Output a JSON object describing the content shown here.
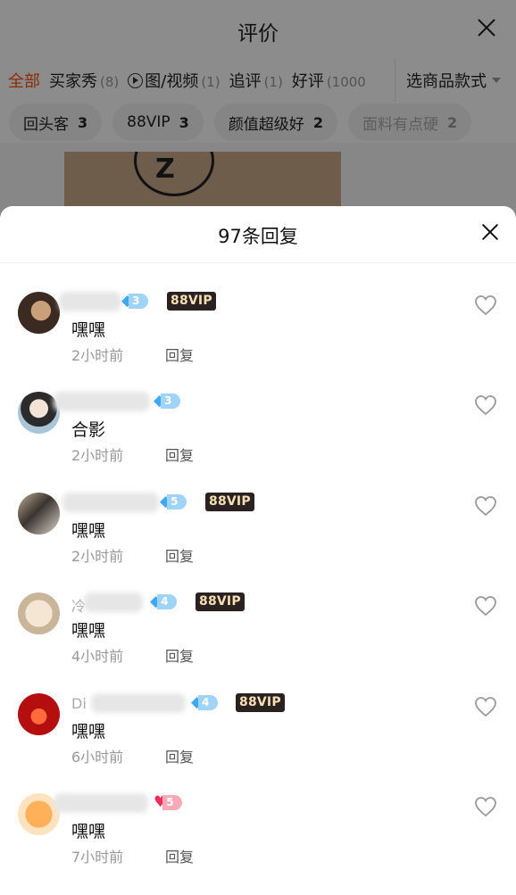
{
  "background": {
    "title": "评价",
    "tabs": [
      {
        "label": "全部",
        "count": ""
      },
      {
        "label": "买家秀",
        "count": "(8)"
      },
      {
        "label": "图/视频",
        "count": "(1)"
      },
      {
        "label": "追评",
        "count": "(1)"
      },
      {
        "label": "好评",
        "count": "(1000"
      }
    ],
    "style_select": "选商品款式",
    "chips": [
      {
        "label": "回头客",
        "count": "3"
      },
      {
        "label": "88VIP",
        "count": "3"
      },
      {
        "label": "颜值超级好",
        "count": "2"
      },
      {
        "label": "面料有点硬",
        "count": "2"
      }
    ],
    "accent_color": "#ff5000"
  },
  "sheet": {
    "title": "97条回复",
    "reply_label": "回复",
    "replies": [
      {
        "name_fragment": "",
        "level": "3",
        "badge": "88VIP",
        "content": "嘿嘿",
        "time": "2小时前"
      },
      {
        "name_fragment": "",
        "level": "3",
        "badge": "",
        "content": "合影",
        "time": "2小时前"
      },
      {
        "name_fragment": "",
        "level": "5",
        "badge": "88VIP",
        "content": "嘿嘿",
        "time": "2小时前"
      },
      {
        "name_fragment": "冷",
        "level": "4",
        "badge": "88VIP",
        "content": "嘿嘿",
        "time": "4小时前"
      },
      {
        "name_fragment": "Di",
        "level": "4",
        "badge": "88VIP",
        "content": "嘿嘿",
        "time": "6小时前"
      },
      {
        "name_fragment": "",
        "level": "5",
        "badge": "",
        "content": "嘿嘿",
        "time": "7小时前"
      }
    ]
  }
}
